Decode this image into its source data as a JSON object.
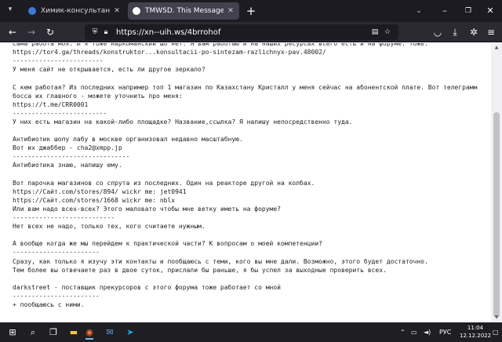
{
  "tabs": [
    {
      "title": "Химик-консультант | RuTOR - ",
      "active": false,
      "favicon_color": "#3a7bd5"
    },
    {
      "title": "TMWSD. This Message Will Self-De",
      "active": true,
      "favicon_color": "#ffffff"
    }
  ],
  "icons": {
    "tab_list": "chevron-down-icon",
    "new_tab": "plus-icon",
    "back": "arrow-left-icon",
    "forward": "arrow-right-icon",
    "reload": "reload-icon",
    "shield": "shield-icon",
    "lock": "lock-icon",
    "reader": "reader-view-icon",
    "bookmark": "star-icon",
    "pocket": "pocket-icon",
    "downloads": "download-icon",
    "account": "account-icon",
    "extensions": "extension-icon",
    "menu": "hamburger-menu-icon"
  },
  "url": "https://xn--uih.ws/4brrohof",
  "lines": [
    "Сама работа моя. И я тоже наркоманский шо нет. Я вам работаю и на наших ресурсах всего есть и на форуме. Тоже:",
    "https://tor4.ga/threads/konstruktor...konsultacii-po-sintezam-razlichnyx-pav.48002/",
    "------------------------",
    "У меня сайт не открывается, есть ли другое зеркало?",
    "",
    "С кем работая? Из последних например топ 1 магазин по Казахстану Кристалл у меня сейчас на абонентской плате. Вот телеграмм",
    "босса их главного - можете уточнить про меня:",
    "https://t.me/CRR0001",
    "-------------------------",
    "У них есть магазин на какой-либо площадке? Название,ссылка? Я напишу непосредственно туда.",
    "",
    "Антибиотик шопу лабу в москве организовал недавно масштабную.",
    "Вот их джаббер - cha2@xmpp.jp",
    "-------------------------------",
    "Антибиотика знаю, напишу ему.",
    "",
    "Вот парочка магазинов со спрута из последних. Один на реакторе другой на колбах.",
    "https://Сайт.com/stores/894/ wickr me: jet0941",
    "https://Сайт.com/stores/1668 wickr me: nblx",
    "Или вам надо всех-всех? Этого маловато чтобы мне ветку иметь на форуме?",
    "---------------------------",
    "Нет всех не надо, только тех, кого считаете нужным.",
    "",
    "А вообще когда же мы перейдем к практической части? К вопросам о моей компетенции?",
    "-----------------------",
    "Сразу, как только я изучу эти контакты и пообщаюсь с теми, кого вы мне дали. Возможно, этого будет достаточно.",
    "Тем более вы отвечаете раз в двое суток, прислали бы раньше, я бы успел за выходные проверить всех.",
    "",
    "darkstreet - поставщик прекурсоров с этого форума тоже работает со мной",
    "-----------------------",
    "+ пообщаюсь с ними."
  ],
  "taskbar": {
    "apps": [
      {
        "name": "start-icon",
        "glyph": "⊞"
      },
      {
        "name": "search-icon",
        "glyph": "⌕"
      },
      {
        "name": "task-view-icon",
        "glyph": "❐"
      },
      {
        "name": "file-explorer-icon",
        "glyph": "▬"
      },
      {
        "name": "firefox-icon",
        "glyph": "◉",
        "running": true
      },
      {
        "name": "mail-icon",
        "glyph": "✉"
      },
      {
        "name": "telegram-icon",
        "glyph": "➤"
      }
    ],
    "tray_language": "РУС",
    "time": "11:04",
    "date": "12.12.2022"
  }
}
